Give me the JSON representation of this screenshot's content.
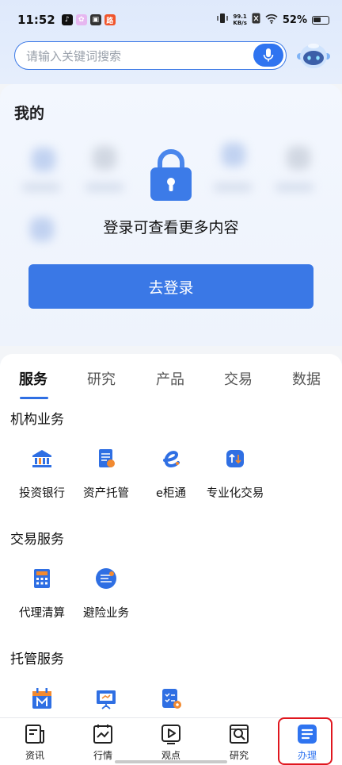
{
  "status_bar": {
    "time": "11:52",
    "net_speed_value": "99.1",
    "net_speed_unit": "KB/s",
    "battery": "52%"
  },
  "search": {
    "placeholder": "请输入关键词搜索"
  },
  "my_section": {
    "title": "我的",
    "login_hint": "登录可查看更多内容",
    "login_button": "去登录"
  },
  "tabs": [
    {
      "label": "服务",
      "active": true
    },
    {
      "label": "研究",
      "active": false
    },
    {
      "label": "产品",
      "active": false
    },
    {
      "label": "交易",
      "active": false
    },
    {
      "label": "数据",
      "active": false
    }
  ],
  "sections": [
    {
      "title": "机构业务",
      "items": [
        {
          "label": "投资银行",
          "icon": "bank-icon"
        },
        {
          "label": "资产托管",
          "icon": "document-icon"
        },
        {
          "label": "e柜通",
          "icon": "e-logo-icon"
        },
        {
          "label": "专业化交易",
          "icon": "trade-arrows-icon"
        }
      ]
    },
    {
      "title": "交易服务",
      "items": [
        {
          "label": "代理清算",
          "icon": "calculator-icon"
        },
        {
          "label": "避险业务",
          "icon": "hedge-badge-icon"
        }
      ]
    },
    {
      "title": "托管服务",
      "items": [
        {
          "label": "",
          "icon": "calendar-m-icon"
        },
        {
          "label": "",
          "icon": "presentation-icon"
        },
        {
          "label": "",
          "icon": "checklist-icon"
        }
      ]
    }
  ],
  "bottom_nav": [
    {
      "label": "资讯",
      "icon": "news-icon",
      "active": false
    },
    {
      "label": "行情",
      "icon": "chart-icon",
      "active": false
    },
    {
      "label": "观点",
      "icon": "play-icon",
      "active": false
    },
    {
      "label": "研究",
      "icon": "search-doc-icon",
      "active": false
    },
    {
      "label": "办理",
      "icon": "list-doc-icon",
      "active": true
    }
  ],
  "colors": {
    "primary": "#2f74f0",
    "login_button": "#3a78e6",
    "highlight": "#e0161e"
  }
}
